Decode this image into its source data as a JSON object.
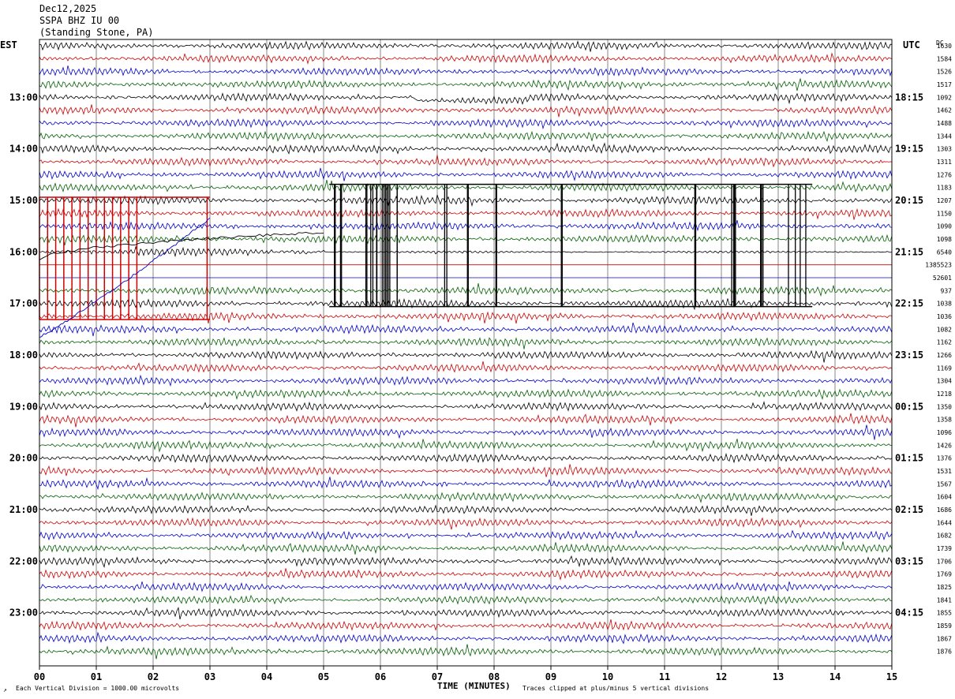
{
  "header": {
    "date": "Dec12,2025",
    "station": "SSPA BHZ IU 00",
    "location": "(Standing Stone, PA)"
  },
  "left_tz": "EST",
  "right_tz": "UTC",
  "right_col_label": "DC",
  "footer": {
    "scale_note": "Each Vertical Division = 1000.00 microvolts",
    "clip_note": "Traces clipped at plus/minus 5 vertical divisions",
    "corner_mark": "↗"
  },
  "chart_data": {
    "type": "line",
    "title": "",
    "xlabel": "TIME (MINUTES)",
    "ylabel": "",
    "xlim": [
      0,
      15
    ],
    "x_ticks": [
      "00",
      "01",
      "02",
      "03",
      "04",
      "05",
      "06",
      "07",
      "08",
      "09",
      "10",
      "11",
      "12",
      "13",
      "14",
      "15"
    ],
    "trace_colors": [
      "#000000",
      "#d00000",
      "#0000d0",
      "#006000"
    ],
    "grid": true,
    "left_hour_labels": [
      {
        "trace": 4,
        "label": "13:00"
      },
      {
        "trace": 8,
        "label": "14:00"
      },
      {
        "trace": 12,
        "label": "15:00"
      },
      {
        "trace": 16,
        "label": "16:00"
      },
      {
        "trace": 20,
        "label": "17:00"
      },
      {
        "trace": 24,
        "label": "18:00"
      },
      {
        "trace": 28,
        "label": "19:00"
      },
      {
        "trace": 32,
        "label": "20:00"
      },
      {
        "trace": 36,
        "label": "21:00"
      },
      {
        "trace": 40,
        "label": "22:00"
      },
      {
        "trace": 44,
        "label": "23:00"
      }
    ],
    "right_hour_labels": [
      {
        "trace": 4,
        "label": "18:15"
      },
      {
        "trace": 8,
        "label": "19:15"
      },
      {
        "trace": 12,
        "label": "20:15"
      },
      {
        "trace": 16,
        "label": "21:15"
      },
      {
        "trace": 20,
        "label": "22:15"
      },
      {
        "trace": 24,
        "label": "23:15"
      },
      {
        "trace": 28,
        "label": "00:15"
      },
      {
        "trace": 32,
        "label": "01:15"
      },
      {
        "trace": 36,
        "label": "02:15"
      },
      {
        "trace": 40,
        "label": "03:15"
      },
      {
        "trace": 44,
        "label": "04:15"
      }
    ],
    "dc_offsets": [
      "1630",
      "1584",
      "1526",
      "1517",
      "1092",
      "1462",
      "1488",
      "1344",
      "1303",
      "1311",
      "1276",
      "1183",
      "1207",
      "1150",
      "1090",
      "1098",
      "6540",
      "1385523",
      "52601",
      "937",
      "1038",
      "1036",
      "1082",
      "1162",
      "1266",
      "1169",
      "1304",
      "1218",
      "1350",
      "1358",
      "1096",
      "1426",
      "1376",
      "1531",
      "1567",
      "1604",
      "1686",
      "1644",
      "1682",
      "1739",
      "1706",
      "1769",
      "1825",
      "1841",
      "1855",
      "1859",
      "1867",
      "1876"
    ],
    "events": [
      {
        "kind": "clipped_bursts",
        "traces": [
          12,
          21
        ],
        "minutes": [
          0.0,
          3.0
        ],
        "color": "#d00000"
      },
      {
        "kind": "clipped_bursts",
        "traces": [
          11,
          20
        ],
        "minutes": [
          5.1,
          13.6
        ],
        "color": "#000000"
      },
      {
        "kind": "drift",
        "trace": 14,
        "from_minute": 0.0,
        "to_minute": 3.0,
        "color": "#0000d0"
      },
      {
        "kind": "drift",
        "trace": 16,
        "from_minute": 0.0,
        "to_minute": 5.0,
        "color": "#000000"
      }
    ]
  }
}
